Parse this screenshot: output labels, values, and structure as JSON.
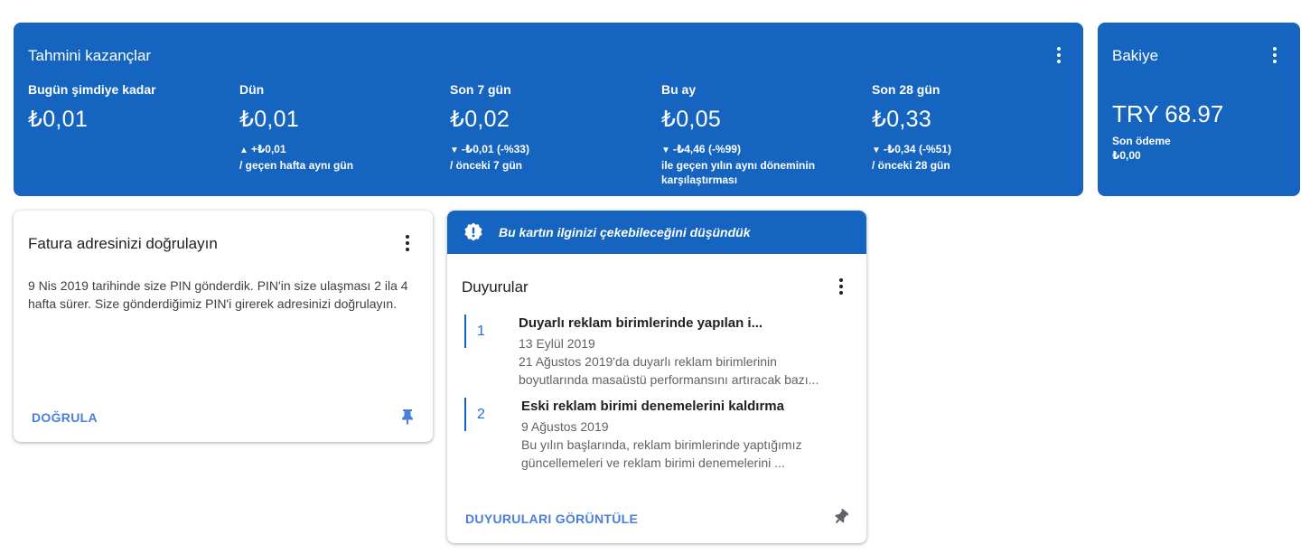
{
  "colors": {
    "primary": "#1565c0",
    "link": "#4a7fd8",
    "text": "#202124"
  },
  "earnings": {
    "title": "Tahmini kazançlar",
    "metrics": [
      {
        "label": "Bugün şimdiye kadar",
        "value": "₺0,01",
        "arrow": "",
        "change": "",
        "note": ""
      },
      {
        "label": "Dün",
        "value": "₺0,01",
        "arrow": "▲",
        "change": "+₺0,01",
        "note": "/ geçen hafta aynı gün"
      },
      {
        "label": "Son 7 gün",
        "value": "₺0,02",
        "arrow": "▼",
        "change": "-₺0,01 (-%33)",
        "note": "/ önceki 7 gün"
      },
      {
        "label": "Bu ay",
        "value": "₺0,05",
        "arrow": "▼",
        "change": "-₺4,46 (-%99)",
        "note": "ile geçen yılın aynı döneminin karşılaştırması"
      },
      {
        "label": "Son 28 gün",
        "value": "₺0,33",
        "arrow": "▼",
        "change": "-₺0,34 (-%51)",
        "note": "/ önceki 28 gün"
      }
    ]
  },
  "balance": {
    "title": "Bakiye",
    "value": "TRY 68.97",
    "last_payment_label": "Son ödeme",
    "last_payment_value": "₺0,00"
  },
  "verify_card": {
    "title": "Fatura adresinizi doğrulayın",
    "body": "9 Nis 2019 tarihinde size PIN gönderdik. PIN'in size ulaşması 2 ila 4 hafta sürer. Size gönderdiğimiz PIN'i girerek adresinizi doğrulayın.",
    "action": "DOĞRULA"
  },
  "news_card": {
    "banner": "Bu kartın ilginizi çekebileceğini düşündük",
    "title": "Duyurular",
    "items": [
      {
        "num": "1",
        "title": "Duyarlı reklam birimlerinde yapılan i...",
        "date": "13 Eylül 2019",
        "desc": "21 Ağustos 2019'da duyarlı reklam birimlerinin boyutlarında masaüstü performansını artıracak bazı..."
      },
      {
        "num": "2",
        "title": "Eski reklam birimi denemelerini kaldırma",
        "date": "9 Ağustos 2019",
        "desc": "Bu yılın başlarında, reklam birimlerinde yaptığımız güncellemeleri ve reklam birimi denemelerini ..."
      }
    ],
    "action": "DUYURULARI GÖRÜNTÜLE"
  }
}
